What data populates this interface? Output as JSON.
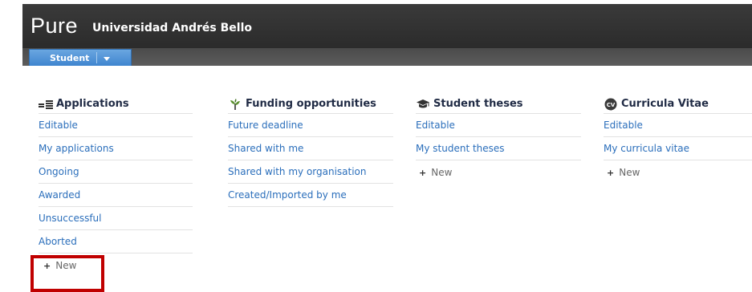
{
  "header": {
    "logo": "Pure",
    "org_name": "Universidad Andrés Bello"
  },
  "rolebar": {
    "role_label": "Student"
  },
  "columns": {
    "applications": {
      "title": "Applications",
      "items": [
        "Editable",
        "My applications",
        "Ongoing",
        "Awarded",
        "Unsuccessful",
        "Aborted"
      ],
      "new_label": "New"
    },
    "funding": {
      "title": "Funding opportunities",
      "items": [
        "Future deadline",
        "Shared with me",
        "Shared with my organisation",
        "Created/Imported by me"
      ]
    },
    "theses": {
      "title": "Student theses",
      "items": [
        "Editable",
        "My student theses"
      ],
      "new_label": "New"
    },
    "cv": {
      "title": "Curricula Vitae",
      "icon_text": "CV",
      "items": [
        "Editable",
        "My curricula vitae"
      ],
      "new_label": "New"
    }
  },
  "colors": {
    "header_bg": "#2b2b2b",
    "role_tab": "#3f85cf",
    "link": "#2a6ebb",
    "highlight": "#c00000"
  },
  "icons": {
    "applications": "applications-list-icon",
    "funding": "funding-sprout-icon",
    "theses": "graduation-cap-icon",
    "cv": "cv-badge-icon",
    "new": "plus-icon",
    "role_menu": "chevron-down-icon"
  }
}
